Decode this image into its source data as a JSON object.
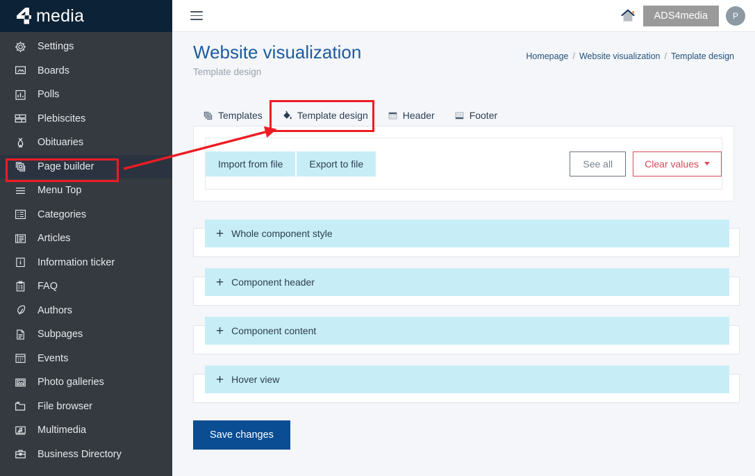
{
  "brand": {
    "logo_text": "media",
    "logo_mark": "four-logo-icon"
  },
  "sidebar": {
    "items": [
      {
        "label": "Settings",
        "icon": "gear-icon",
        "active": false
      },
      {
        "label": "Boards",
        "icon": "board-icon",
        "active": false
      },
      {
        "label": "Polls",
        "icon": "bar-chart-icon",
        "active": false
      },
      {
        "label": "Plebiscites",
        "icon": "split-rows-icon",
        "active": false
      },
      {
        "label": "Obituaries",
        "icon": "ribbon-icon",
        "active": false
      },
      {
        "label": "Page builder",
        "icon": "layers-icon",
        "active": true
      },
      {
        "label": "Menu Top",
        "icon": "hamburger-icon",
        "active": false
      },
      {
        "label": "Categories",
        "icon": "list-icon",
        "active": false
      },
      {
        "label": "Articles",
        "icon": "newspaper-icon",
        "active": false
      },
      {
        "label": "Information ticker",
        "icon": "info-icon",
        "active": false
      },
      {
        "label": "FAQ",
        "icon": "clipboard-icon",
        "active": false
      },
      {
        "label": "Authors",
        "icon": "feather-icon",
        "active": false
      },
      {
        "label": "Subpages",
        "icon": "document-icon",
        "active": false
      },
      {
        "label": "Events",
        "icon": "calendar-icon",
        "active": false
      },
      {
        "label": "Photo galleries",
        "icon": "image-icon",
        "active": false
      },
      {
        "label": "File browser",
        "icon": "folder-icon",
        "active": false
      },
      {
        "label": "Multimedia",
        "icon": "music-frame-icon",
        "active": false
      },
      {
        "label": "Business Directory",
        "icon": "briefcase-icon",
        "active": false
      }
    ]
  },
  "topbar": {
    "menu_icon": "hamburger-icon",
    "home_icon": "home-icon",
    "brand_chip": "ADS4media",
    "avatar_initial": "P"
  },
  "page": {
    "title": "Website visualization",
    "subtitle": "Template design"
  },
  "breadcrumb": {
    "items": [
      "Homepage",
      "Website visualization",
      "Template design"
    ],
    "separator": "/"
  },
  "tabs": [
    {
      "label": "Templates",
      "icon": "layers-icon",
      "active": false
    },
    {
      "label": "Template design",
      "icon": "paint-can-icon",
      "active": true
    },
    {
      "label": "Header",
      "icon": "header-icon",
      "active": false
    },
    {
      "label": "Footer",
      "icon": "footer-icon",
      "active": false
    }
  ],
  "toolbar": {
    "import_label": "Import from file",
    "export_label": "Export to file",
    "see_all_label": "See all",
    "clear_values_label": "Clear values",
    "clear_values_caret": "chevron-down-icon"
  },
  "accordions": [
    {
      "plus": "+",
      "title": "Whole component style"
    },
    {
      "plus": "+",
      "title": "Component header"
    },
    {
      "plus": "+",
      "title": "Component content"
    },
    {
      "plus": "+",
      "title": "Hover view"
    }
  ],
  "footer_actions": {
    "save_label": "Save changes"
  },
  "annotations": {
    "highlight_color": "#ee1c24",
    "boxes": [
      "sidebar-page-builder",
      "tab-template-design"
    ],
    "arrow": "points from Page builder sidebar item to Template design tab"
  },
  "colors": {
    "sidebar_bg": "#353a40",
    "logo_bg": "#0c2237",
    "accent_cyan": "#c7eef6",
    "primary_blue": "#0a4d92",
    "title_blue": "#1c5c9e",
    "danger_red": "#d9475a",
    "page_bg": "#f4f6f9"
  }
}
